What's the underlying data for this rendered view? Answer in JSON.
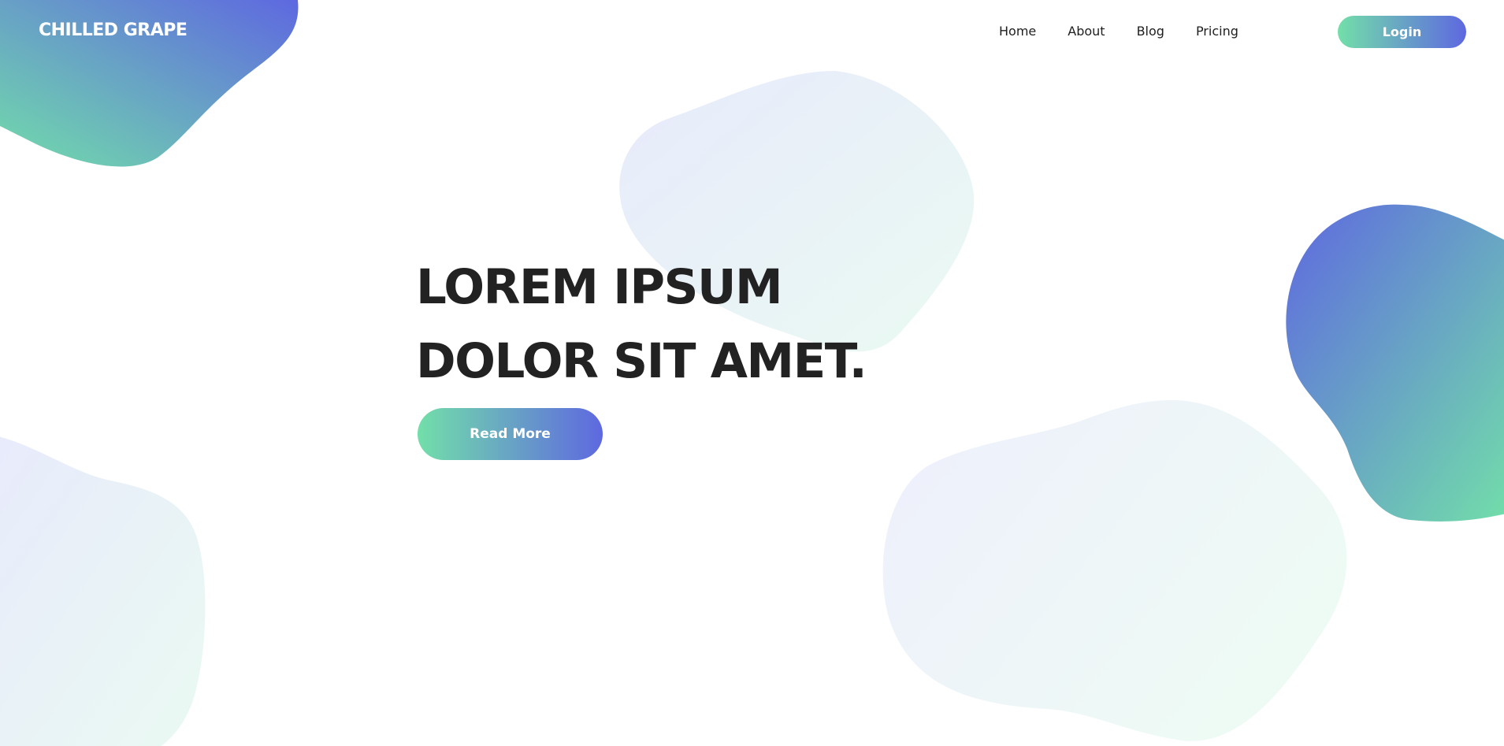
{
  "brand": {
    "name": "CHILLED GRAPE"
  },
  "nav": {
    "items": [
      {
        "label": "Home"
      },
      {
        "label": "About"
      },
      {
        "label": "Blog"
      },
      {
        "label": "Pricing"
      }
    ],
    "login_label": "Login"
  },
  "hero": {
    "title_line1": "LOREM IPSUM",
    "title_line2": "DOLOR SIT AMET.",
    "cta_label": "Read More"
  },
  "colors": {
    "gradient_start": "#72dfa9",
    "gradient_end": "#5e68e0",
    "text_dark": "#222222",
    "background": "#ffffff"
  }
}
